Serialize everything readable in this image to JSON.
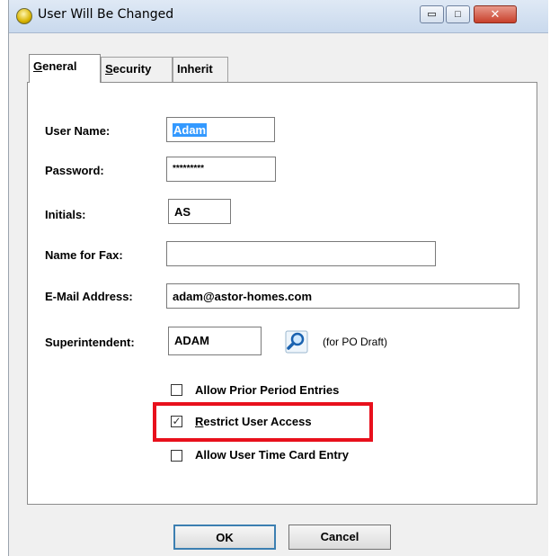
{
  "window": {
    "title": "User Will Be Changed",
    "minimize_glyph": "▭",
    "maximize_glyph": "□",
    "close_glyph": "✕"
  },
  "tabs": [
    {
      "label": "General",
      "accel": "G",
      "rest": "eneral",
      "selected": true
    },
    {
      "label": "Security",
      "accel": "S",
      "rest": "ecurity",
      "selected": false
    },
    {
      "label": "Inherit",
      "accel": "",
      "rest": "Inherit",
      "selected": false
    }
  ],
  "form": {
    "user_name": {
      "label": "User Name:",
      "value": "Adam"
    },
    "password": {
      "label": "Password:",
      "value": "*********"
    },
    "initials": {
      "label": "Initials:",
      "value": "AS"
    },
    "name_for_fax": {
      "label": "Name for Fax:",
      "value": ""
    },
    "email": {
      "label": "E-Mail Address:",
      "value": "adam@astor-homes.com"
    },
    "superintendent": {
      "label": "Superintendent:",
      "value": "ADAM",
      "hint": "(for PO Draft)"
    }
  },
  "checkboxes": {
    "allow_prior": {
      "label": "Allow Prior Period Entries",
      "checked": false
    },
    "restrict_access": {
      "label": "Restrict User Access",
      "accel": "R",
      "rest": "estrict User Access",
      "checked": true
    },
    "allow_timecard": {
      "label": "Allow User Time Card Entry",
      "checked": false
    }
  },
  "buttons": {
    "ok": "OK",
    "cancel": "Cancel"
  },
  "colors": {
    "highlight": "#e8101c",
    "selection": "#3399ff"
  },
  "icons": {
    "title": "user-app-icon",
    "lookup": "magnifier-icon"
  }
}
